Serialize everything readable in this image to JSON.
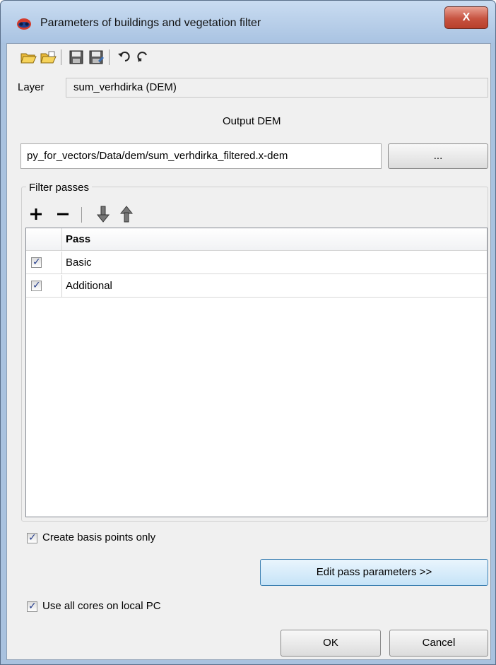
{
  "window": {
    "title": "Parameters of buildings and vegetation filter",
    "close_glyph": "X"
  },
  "toolbar": {
    "items": [
      "open-icon",
      "open-list-icon",
      "save-icon",
      "save-as-icon",
      "undo-icon",
      "redo-icon"
    ]
  },
  "layer": {
    "label": "Layer",
    "value": "sum_verhdirka (DEM)"
  },
  "output": {
    "label": "Output DEM",
    "path": "py_for_vectors/Data/dem/sum_verhdirka_filtered.x-dem",
    "browse_label": "..."
  },
  "filter_passes": {
    "title": "Filter passes",
    "column_header": "Pass",
    "rows": [
      {
        "label": "Basic",
        "checked": true
      },
      {
        "label": "Additional",
        "checked": true
      }
    ]
  },
  "options": {
    "basis_points_label": "Create basis points only",
    "edit_pass_label": "Edit pass parameters >>",
    "all_cores_label": "Use all cores on local PC"
  },
  "buttons": {
    "ok": "OK",
    "cancel": "Cancel"
  },
  "colors": {
    "titlebar": "#b9d0ea",
    "close": "#c75340",
    "dialog_bg": "#f0f0f0",
    "check_mark": "#243c8a"
  }
}
